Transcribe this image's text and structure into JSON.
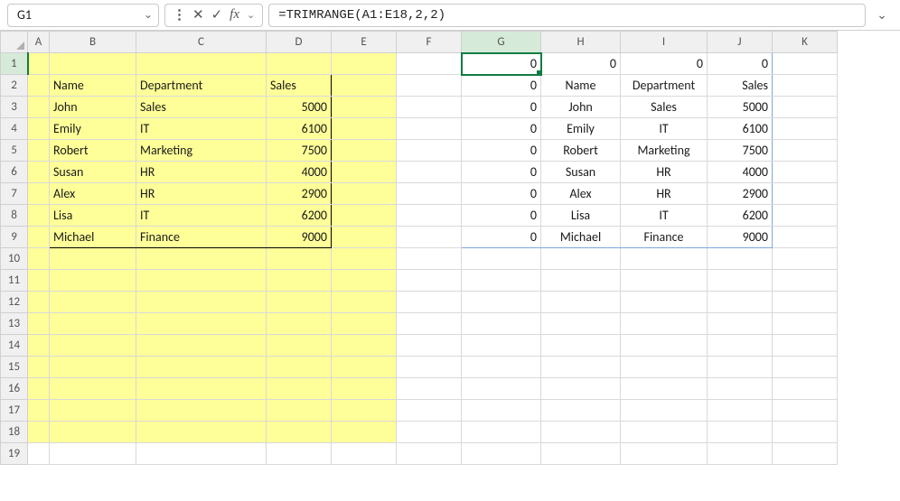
{
  "formula_bar": {
    "cell_ref": "G1",
    "formula": "=TRIMRANGE(A1:E18,2,2)"
  },
  "columns": [
    "A",
    "B",
    "C",
    "D",
    "E",
    "F",
    "G",
    "H",
    "I",
    "J",
    "K"
  ],
  "column_classes": [
    "cA",
    "cB",
    "cC",
    "cD",
    "cE",
    "cF",
    "cG",
    "cH",
    "cI",
    "cJ",
    "cK"
  ],
  "row_count": 19,
  "source_table": {
    "headers": [
      "Name",
      "Department",
      "Sales"
    ],
    "rows": [
      {
        "name": "John",
        "dept": "Sales",
        "sales": 5000
      },
      {
        "name": "Emily",
        "dept": "IT",
        "sales": 6100
      },
      {
        "name": "Robert",
        "dept": "Marketing",
        "sales": 7500
      },
      {
        "name": "Susan",
        "dept": "HR",
        "sales": 4000
      },
      {
        "name": "Alex",
        "dept": "HR",
        "sales": 2900
      },
      {
        "name": "Lisa",
        "dept": "IT",
        "sales": 6200
      },
      {
        "name": "Michael",
        "dept": "Finance",
        "sales": 9000
      }
    ]
  },
  "spill": {
    "cols": [
      "G",
      "H",
      "I",
      "J"
    ],
    "rows": [
      [
        "0",
        "0",
        "0",
        "0"
      ],
      [
        "0",
        "Name",
        "Department",
        "Sales"
      ],
      [
        "0",
        "John",
        "Sales",
        "5000"
      ],
      [
        "0",
        "Emily",
        "IT",
        "6100"
      ],
      [
        "0",
        "Robert",
        "Marketing",
        "7500"
      ],
      [
        "0",
        "Susan",
        "HR",
        "4000"
      ],
      [
        "0",
        "Alex",
        "HR",
        "2900"
      ],
      [
        "0",
        "Lisa",
        "IT",
        "6200"
      ],
      [
        "0",
        "Michael",
        "Finance",
        "9000"
      ]
    ]
  },
  "active_cell": "G1",
  "chart_data": {
    "type": "table",
    "title": "TRIMRANGE spill result (G1:J9)",
    "columns": [
      "G",
      "H",
      "I",
      "J"
    ],
    "rows": [
      [
        0,
        0,
        0,
        0
      ],
      [
        0,
        "Name",
        "Department",
        "Sales"
      ],
      [
        0,
        "John",
        "Sales",
        5000
      ],
      [
        0,
        "Emily",
        "IT",
        6100
      ],
      [
        0,
        "Robert",
        "Marketing",
        7500
      ],
      [
        0,
        "Susan",
        "HR",
        4000
      ],
      [
        0,
        "Alex",
        "HR",
        2900
      ],
      [
        0,
        "Lisa",
        "IT",
        6200
      ],
      [
        0,
        "Michael",
        "Finance",
        9000
      ]
    ]
  }
}
